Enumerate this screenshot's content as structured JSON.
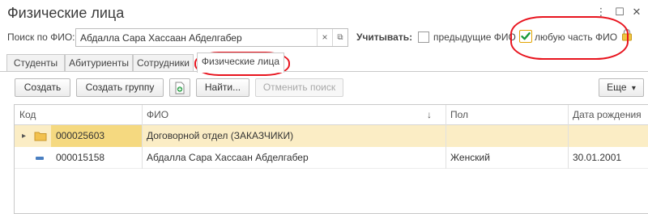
{
  "window": {
    "title": "Физические лица",
    "more_glyph": "⋮",
    "maximize_glyph": "☐",
    "close_glyph": "✕"
  },
  "search": {
    "label": "Поиск по ФИО:",
    "value": "Абдалла Сара Хассаан Абделгабер",
    "clear_glyph": "×",
    "open_glyph": "⧉"
  },
  "options": {
    "label": "Учитывать:",
    "previous_fio": {
      "label": "предыдущие ФИО",
      "checked": false
    },
    "any_part_fio": {
      "label": "любую часть ФИО",
      "checked": true
    }
  },
  "tabs": [
    {
      "label": "Студенты"
    },
    {
      "label": "Абитуриенты"
    },
    {
      "label": "Сотрудники"
    },
    {
      "label": "Физические лица",
      "active": true
    }
  ],
  "toolbar": {
    "create": "Создать",
    "create_group": "Создать группу",
    "find": "Найти...",
    "cancel_search": "Отменить поиск",
    "more": "Еще",
    "more_arrow": "▾"
  },
  "table": {
    "columns": [
      "Код",
      "ФИО",
      "Пол",
      "Дата рождения"
    ],
    "sort_arrow": "↓",
    "expand_arrow": "▸",
    "rows": [
      {
        "code": "000025603",
        "fio": "Договорной отдел (ЗАКАЗЧИКИ)",
        "gender": "",
        "birth_date": "",
        "is_group": true
      },
      {
        "code": "000015158",
        "fio": "Абдалла Сара Хассаан Абделгабер",
        "gender": "Женский",
        "birth_date": "30.01.2001",
        "is_group": false
      }
    ]
  },
  "colors": {
    "accent_red": "#e8141e",
    "group_row": "#fbedc5",
    "selected_cell": "#f5d980",
    "checkbox_green": "#1a9a3a"
  }
}
